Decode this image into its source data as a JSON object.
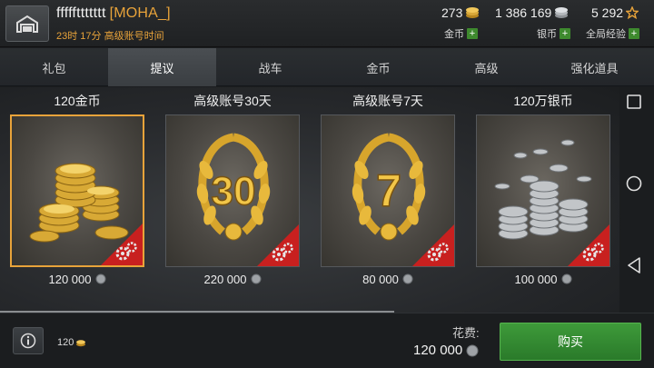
{
  "header": {
    "player_name": "fffffttttttt",
    "clan_tag": "[MOHA_]",
    "premium_time": "23时 17分 高级账号时间"
  },
  "resources": {
    "gold": {
      "value": "273",
      "label": "金币",
      "add": "+"
    },
    "silver": {
      "value": "1 386 169",
      "label": "银币",
      "add": "+"
    },
    "xp": {
      "value": "5 292",
      "label": "全局经验",
      "add": "+"
    }
  },
  "tabs": [
    {
      "label": "礼包"
    },
    {
      "label": "提议"
    },
    {
      "label": "战车"
    },
    {
      "label": "金币"
    },
    {
      "label": "高级"
    },
    {
      "label": "强化道具"
    }
  ],
  "active_tab": "提议",
  "offers": [
    {
      "title": "120金币",
      "price": "120 000",
      "icon": "gold-coins",
      "selected": true
    },
    {
      "title": "高级账号30天",
      "price": "220 000",
      "icon": "laurel-30",
      "badge": "30"
    },
    {
      "title": "高级账号7天",
      "price": "80 000",
      "icon": "laurel-7",
      "badge": "7"
    },
    {
      "title": "120万银币",
      "price": "100 000",
      "icon": "silver-coins"
    }
  ],
  "footer": {
    "selected_amount": "120",
    "cost_label": "花费:",
    "cost_value": "120 000",
    "buy_label": "购买"
  },
  "colors": {
    "accent_gold": "#e8a33a",
    "buy_green": "#3e9a3a",
    "corner_red": "#c8201f"
  }
}
